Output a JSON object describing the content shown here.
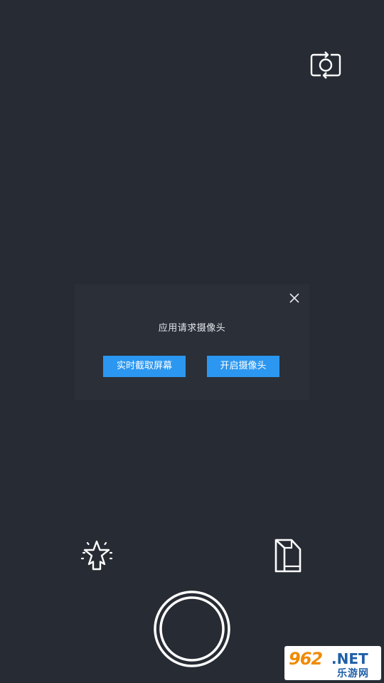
{
  "top_bar": {
    "switch_camera_icon": "camera-switch-icon"
  },
  "dialog": {
    "close_icon": "close-icon",
    "message": "应用请求摄像头",
    "buttons": {
      "screen_capture": "实时截取屏幕",
      "open_camera": "开启摄像头"
    },
    "button_color": "#2b97f0"
  },
  "bottom_bar": {
    "effects_icon": "sparkle-star-icon",
    "gallery_icon": "document-icon",
    "shutter_icon": "shutter-button"
  },
  "watermark": {
    "number": "962",
    "domain": ".NET",
    "subtitle": "乐游网"
  },
  "colors": {
    "background": "#272b33",
    "dialog_background": "#2a2f38",
    "icon": "#ffffff",
    "accent": "#2b97f0"
  }
}
